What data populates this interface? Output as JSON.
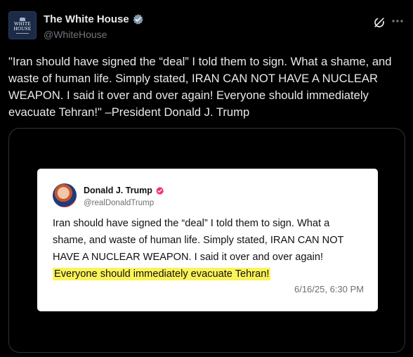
{
  "post": {
    "author": {
      "display_name": "The White House",
      "handle": "@WhiteHouse",
      "avatar_logo_lines": [
        "WHITE",
        "HOUSE"
      ],
      "verified_badge_color": "#829aab"
    },
    "text": "\"Iran should have signed the “deal” I told them to sign. What a shame, and\nwaste of human life. Simply stated, IRAN CAN NOT HAVE A NUCLEAR\nWEAPON. I said it over and over again! Everyone should immediately\nevacuate Tehran!\" –President Donald J. Trump",
    "icons": [
      "grok-icon",
      "more-icon"
    ]
  },
  "embedded_post": {
    "author": {
      "display_name": "Donald J. Trump",
      "handle": "@realDonaldTrump",
      "verified_badge_color": "#f2356d"
    },
    "text_line1": "Iran should have signed the “deal” I told them to sign. What a",
    "text_line2": "shame, and waste of human life. Simply stated, IRAN CAN NOT",
    "text_line3": "HAVE A NUCLEAR WEAPON. I said it over and over again!",
    "highlighted_text": "Everyone should immediately evacuate Tehran!",
    "highlight_color": "#fbf35a",
    "timestamp": "6/16/25, 6:30 PM"
  }
}
